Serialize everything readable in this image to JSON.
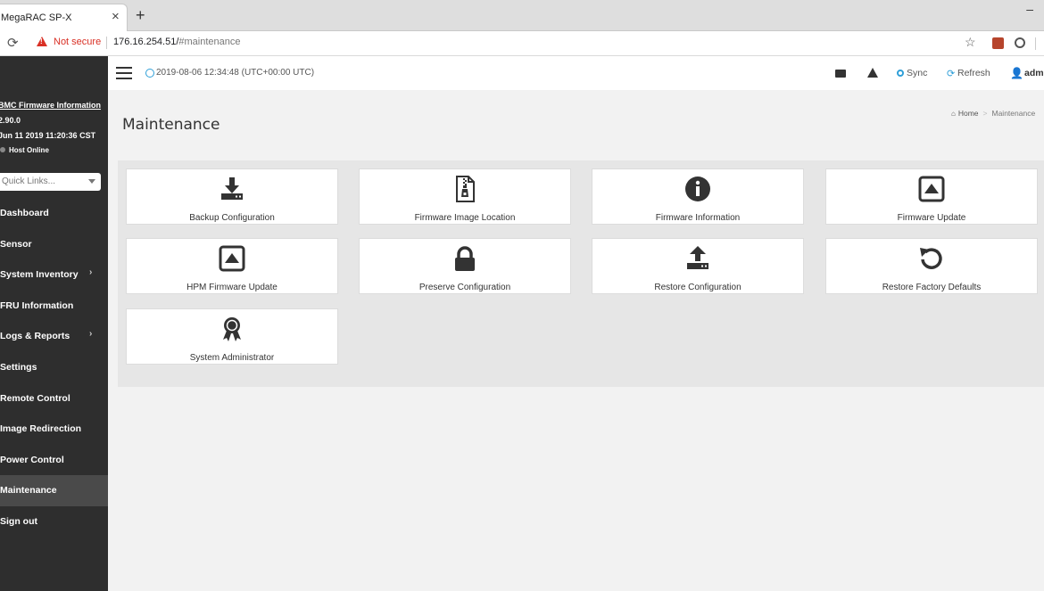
{
  "browser": {
    "tab_title": "MegaRAC SP-X",
    "tab_close": "×",
    "new_tab": "+",
    "minimize": "–",
    "not_secure": "Not secure",
    "url_host": "176.16.254.51/",
    "url_path": "#maintenance"
  },
  "sidebar": {
    "fw_info_label": "BMC Firmware Information",
    "fw_version": "2.90.0",
    "fw_date": "Jun 11 2019 11:20:36 CST",
    "host_status": "Host Online",
    "quick_links_placeholder": "Quick Links...",
    "items": [
      {
        "label": "Dashboard",
        "has_submenu": false,
        "active": false
      },
      {
        "label": "Sensor",
        "has_submenu": false,
        "active": false
      },
      {
        "label": "System Inventory",
        "has_submenu": true,
        "active": false
      },
      {
        "label": "FRU Information",
        "has_submenu": false,
        "active": false
      },
      {
        "label": "Logs & Reports",
        "has_submenu": true,
        "active": false
      },
      {
        "label": "Settings",
        "has_submenu": false,
        "active": false
      },
      {
        "label": "Remote Control",
        "has_submenu": false,
        "active": false
      },
      {
        "label": "Image Redirection",
        "has_submenu": false,
        "active": false
      },
      {
        "label": "Power Control",
        "has_submenu": false,
        "active": false
      },
      {
        "label": "Maintenance",
        "has_submenu": false,
        "active": true
      },
      {
        "label": "Sign out",
        "has_submenu": false,
        "active": false
      }
    ]
  },
  "header": {
    "datetime": "2019-08-06 12:34:48 (UTC+00:00 UTC)",
    "sync_label": "Sync",
    "refresh_label": "Refresh",
    "user_label": "admin"
  },
  "main": {
    "title": "Maintenance",
    "breadcrumb_home": "Home",
    "breadcrumb_current": "Maintenance",
    "cards": [
      {
        "label": "Backup Configuration",
        "icon": "download-icon"
      },
      {
        "label": "Firmware Image Location",
        "icon": "zip-file-icon"
      },
      {
        "label": "Firmware Information",
        "icon": "info-icon"
      },
      {
        "label": "Firmware Update",
        "icon": "upload-box-icon"
      },
      {
        "label": "HPM Firmware Update",
        "icon": "upload-box-icon"
      },
      {
        "label": "Preserve Configuration",
        "icon": "lock-icon"
      },
      {
        "label": "Restore Configuration",
        "icon": "upload-icon"
      },
      {
        "label": "Restore Factory Defaults",
        "icon": "undo-icon"
      },
      {
        "label": "System Administrator",
        "icon": "award-icon"
      }
    ]
  },
  "colors": {
    "sidebar_bg": "#2e2e2e",
    "accent": "#2f9fd8",
    "warning": "#d93025"
  }
}
